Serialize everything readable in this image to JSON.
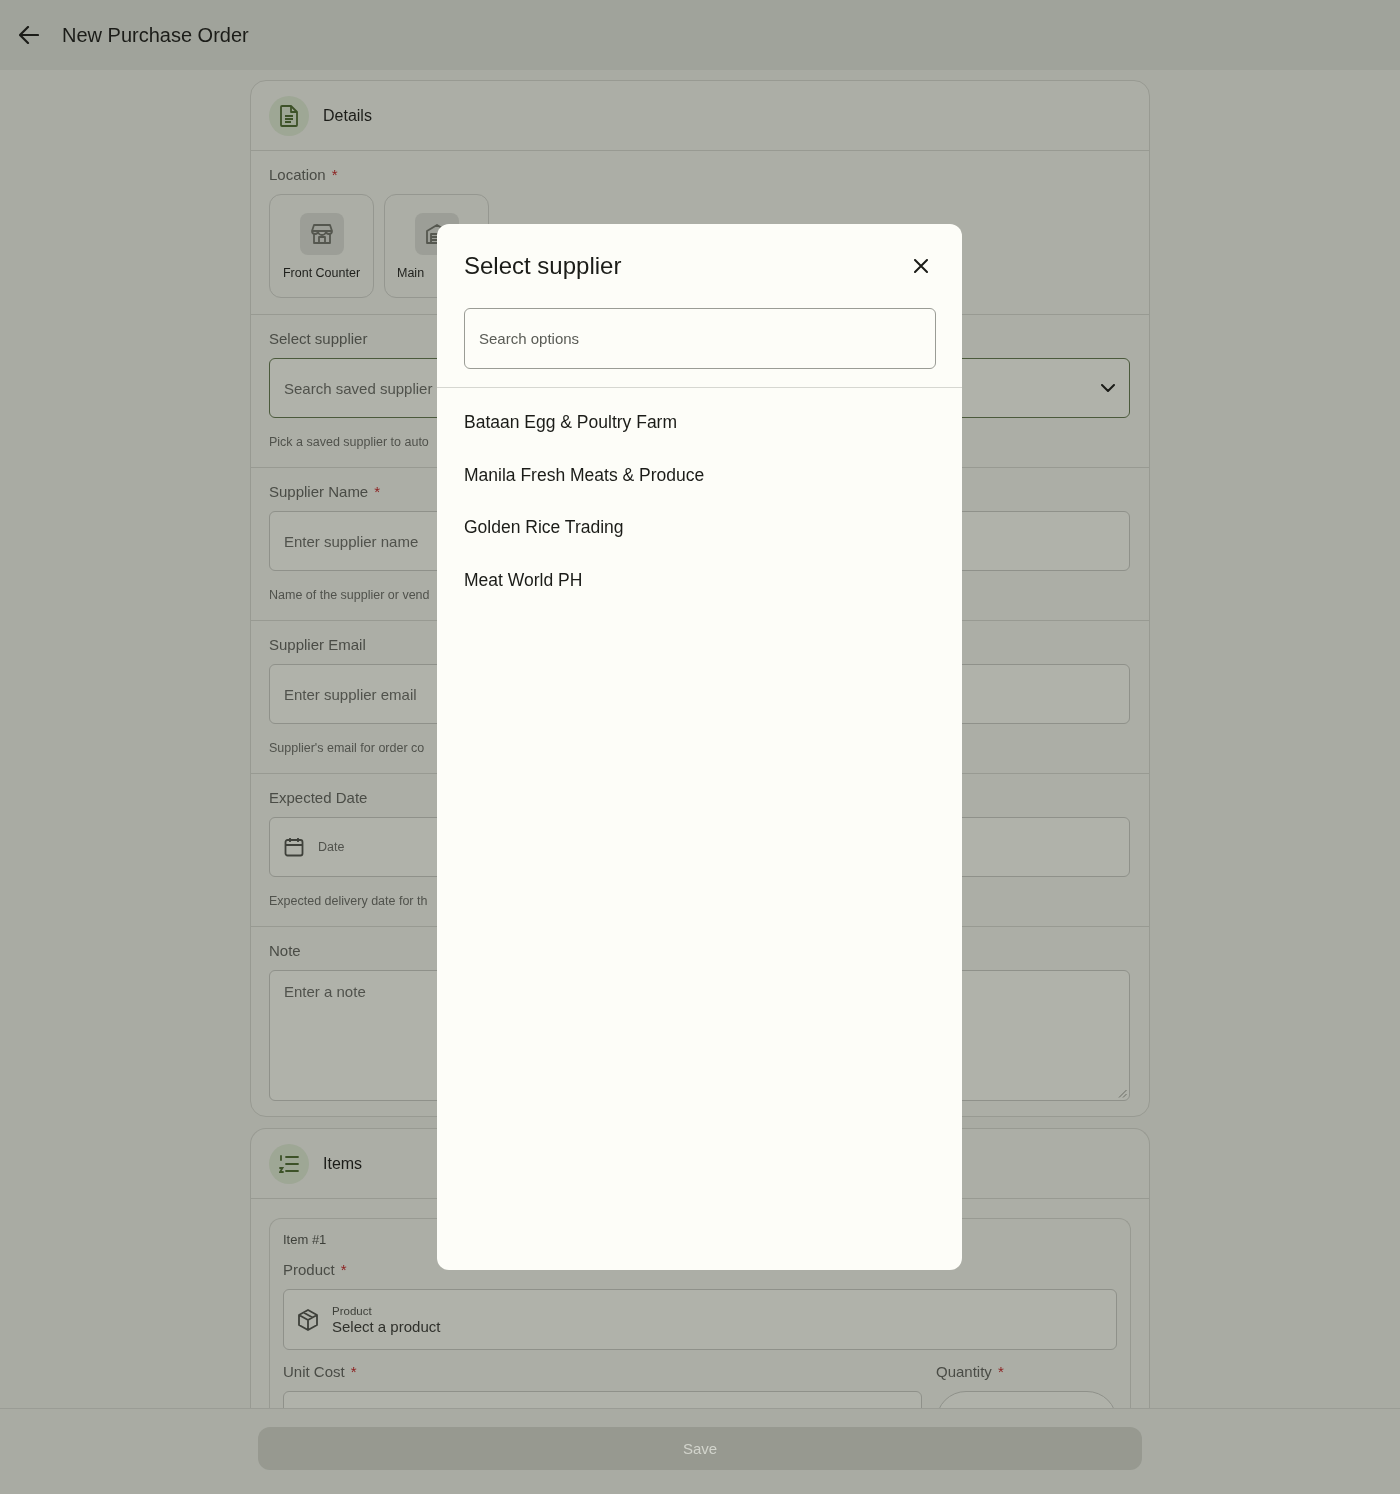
{
  "header": {
    "title": "New Purchase Order"
  },
  "details": {
    "title": "Details",
    "location": {
      "label": "Location",
      "required_mark": "*",
      "options": [
        {
          "label": "Front Counter",
          "selected": false
        },
        {
          "label": "Main",
          "selected": false
        }
      ]
    },
    "fields": [
      {
        "kind": "select",
        "label": "Select supplier",
        "placeholder": "Search saved supplier",
        "helper": "Pick a saved supplier to auto",
        "focused": true
      },
      {
        "kind": "text",
        "label": "Supplier Name",
        "required_mark": "*",
        "placeholder": "Enter supplier name",
        "helper": "Name of the supplier or vend",
        "focused": false
      },
      {
        "kind": "text",
        "label": "Supplier Email",
        "placeholder": "Enter supplier email",
        "helper": "Supplier's email for order co",
        "focused": false
      },
      {
        "kind": "date",
        "label": "Expected Date",
        "placeholder": "Date",
        "helper": "Expected delivery date for th",
        "focused": false
      },
      {
        "kind": "textarea",
        "label": "Note",
        "placeholder": "Enter a note",
        "focused": false
      }
    ]
  },
  "items": {
    "title": "Items",
    "item": {
      "title": "Item #1",
      "product": {
        "label": "Product",
        "required_mark": "*",
        "floating_label": "Product",
        "placeholder": "Select a product"
      },
      "unit_cost": {
        "label": "Unit Cost",
        "required_mark": "*"
      },
      "quantity": {
        "label": "Quantity",
        "required_mark": "*"
      }
    }
  },
  "save": {
    "label": "Save",
    "disabled": true
  },
  "modal": {
    "title": "Select supplier",
    "search": {
      "placeholder": "Search options"
    },
    "options": [
      {
        "label": "Bataan Egg & Poultry Farm"
      },
      {
        "label": "Manila Fresh Meats & Produce"
      },
      {
        "label": "Golden Rice Trading"
      },
      {
        "label": "Meat World PH"
      }
    ]
  }
}
